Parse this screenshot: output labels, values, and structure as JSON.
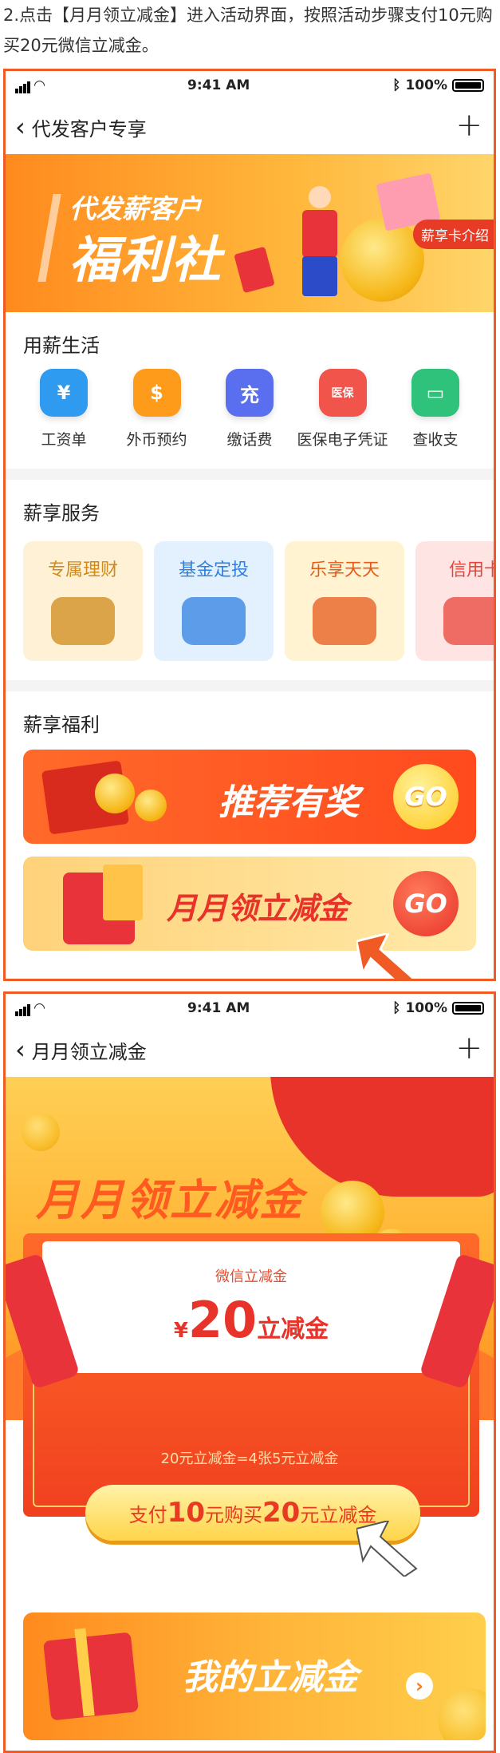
{
  "instruction": "2.点击【月月领立减金】进入活动界面，按照活动步骤支付10元购买20元微信立减金。",
  "status_bar": {
    "time": "9:41 AM",
    "battery": "100%"
  },
  "screen1": {
    "nav_title": "代发客户专享",
    "banner": {
      "line1": "代发薪客户",
      "line2": "福利社",
      "pill": "薪享卡介绍"
    },
    "section_life": {
      "title": "用薪生活",
      "items": [
        {
          "label": "工资单",
          "glyph": "¥",
          "color": "#2f9bf0",
          "icon": "payslip-icon"
        },
        {
          "label": "外币预约",
          "glyph": "$",
          "color": "#ff9b1a",
          "icon": "money-bag-icon"
        },
        {
          "label": "缴话费",
          "glyph": "充",
          "color": "#5a6ff0",
          "icon": "phone-recharge-icon"
        },
        {
          "label": "医保电子凭证",
          "glyph": "医保",
          "color": "#f0544a",
          "icon": "medical-card-icon"
        },
        {
          "label": "查收支",
          "glyph": "▭",
          "color": "#2ec27a",
          "icon": "wallet-icon"
        }
      ]
    },
    "section_service": {
      "title": "薪享服务",
      "cards": [
        {
          "label": "专属理财",
          "bg": "#fff1d6",
          "fg": "#d08a1a"
        },
        {
          "label": "基金定投",
          "bg": "#e3f1ff",
          "fg": "#2f7fe0"
        },
        {
          "label": "乐享天天",
          "bg": "#fff3d1",
          "fg": "#e65a1a"
        },
        {
          "label": "信用卡",
          "bg": "#ffe4e4",
          "fg": "#e8443a"
        }
      ]
    },
    "section_welfare": {
      "title": "薪享福利",
      "promo1": "推荐有奖",
      "promo2": "月月领立减金",
      "go": "GO"
    }
  },
  "screen2": {
    "nav_title": "月月领立减金",
    "hero_title": "月月领立减金",
    "letter_small": "微信立减金",
    "amount_symbol": "¥",
    "amount": "20",
    "amount_unit": "立减金",
    "equation": "20元立减金=4张5元立减金",
    "buy": {
      "pre": "支付",
      "n1": "10",
      "mid": "元购买",
      "n2": "20",
      "post": "元立减金"
    },
    "my_banner": "我的立减金"
  },
  "colors": {
    "accent": "#f05a24",
    "red": "#e8332a",
    "gold": "#ffc43a"
  }
}
